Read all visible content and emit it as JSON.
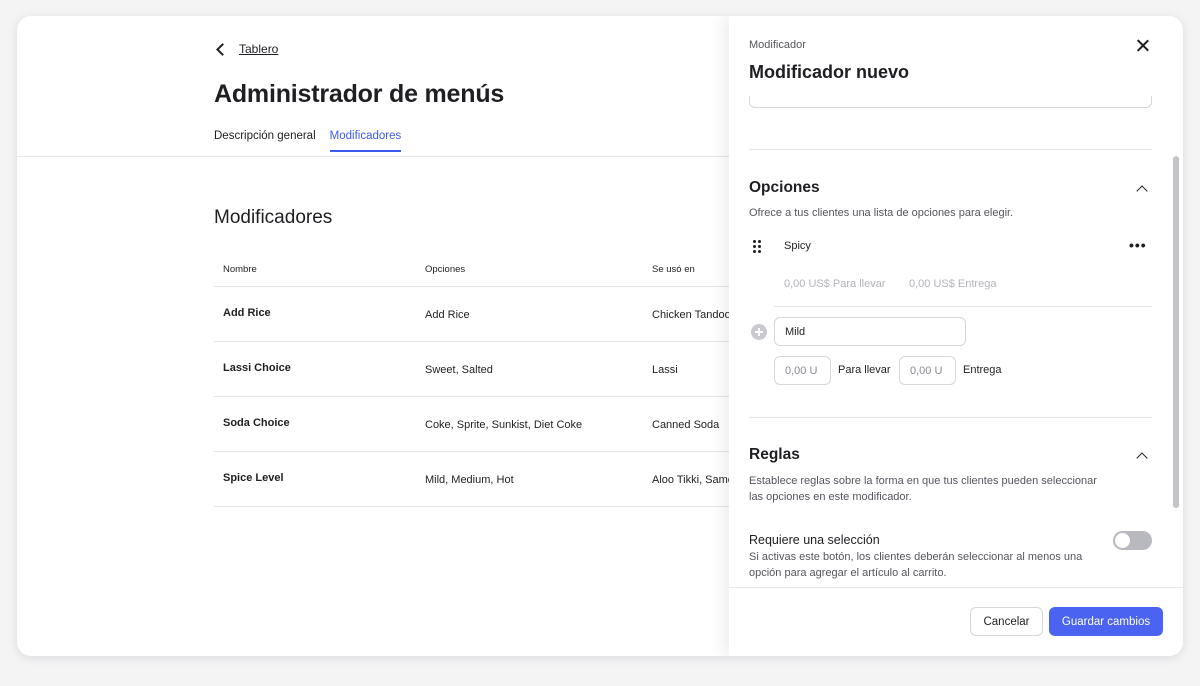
{
  "main": {
    "back_label": "Tablero",
    "title": "Administrador de menús",
    "tabs": [
      {
        "label": "Descripción general"
      },
      {
        "label": "Modificadores"
      }
    ],
    "section_title": "Modificadores",
    "table": {
      "headers": [
        "Nombre",
        "Opciones",
        "Se usó en"
      ],
      "rows": [
        {
          "name": "Add Rice",
          "options": "Add Rice",
          "used_in": "Chicken Tandoori"
        },
        {
          "name": "Lassi Choice",
          "options": "Sweet, Salted",
          "used_in": "Lassi"
        },
        {
          "name": "Soda Choice",
          "options": "Coke, Sprite, Sunkist, Diet Coke",
          "used_in": "Canned Soda"
        },
        {
          "name": "Spice Level",
          "options": "Mild, Medium, Hot",
          "used_in": "Aloo Tikki, Samosa"
        }
      ]
    }
  },
  "panel": {
    "subtitle": "Modificador",
    "title": "Modificador nuevo",
    "options_section": {
      "title": "Opciones",
      "description": "Ofrece a tus clientes una lista de opciones para elegir.",
      "existing_option": {
        "name": "Spicy",
        "pickup_price": "0,00 US$ Para llevar",
        "delivery_price": "0,00 US$ Entrega"
      },
      "new_option": {
        "name_value": "Mild",
        "pickup_value": "0,00 U",
        "pickup_label": "Para llevar",
        "delivery_value": "0,00 U",
        "delivery_label": "Entrega"
      }
    },
    "rules_section": {
      "title": "Reglas",
      "description_line1": "Establece reglas sobre la forma en que tus clientes pueden seleccionar",
      "description_line2": "las opciones en este modificador.",
      "require_selection": {
        "label": "Requiere una selección",
        "help_line1": "Si activas este botón, los clientes deberán seleccionar al menos una",
        "help_line2": "opción para agregar el artículo al carrito.",
        "enabled": false
      }
    },
    "footer": {
      "cancel_label": "Cancelar",
      "save_label": "Guardar cambios"
    }
  },
  "colors": {
    "accent": "#4a63f0",
    "tab_active": "#3e5bf0",
    "toggle_off": "#b8b8bf"
  }
}
